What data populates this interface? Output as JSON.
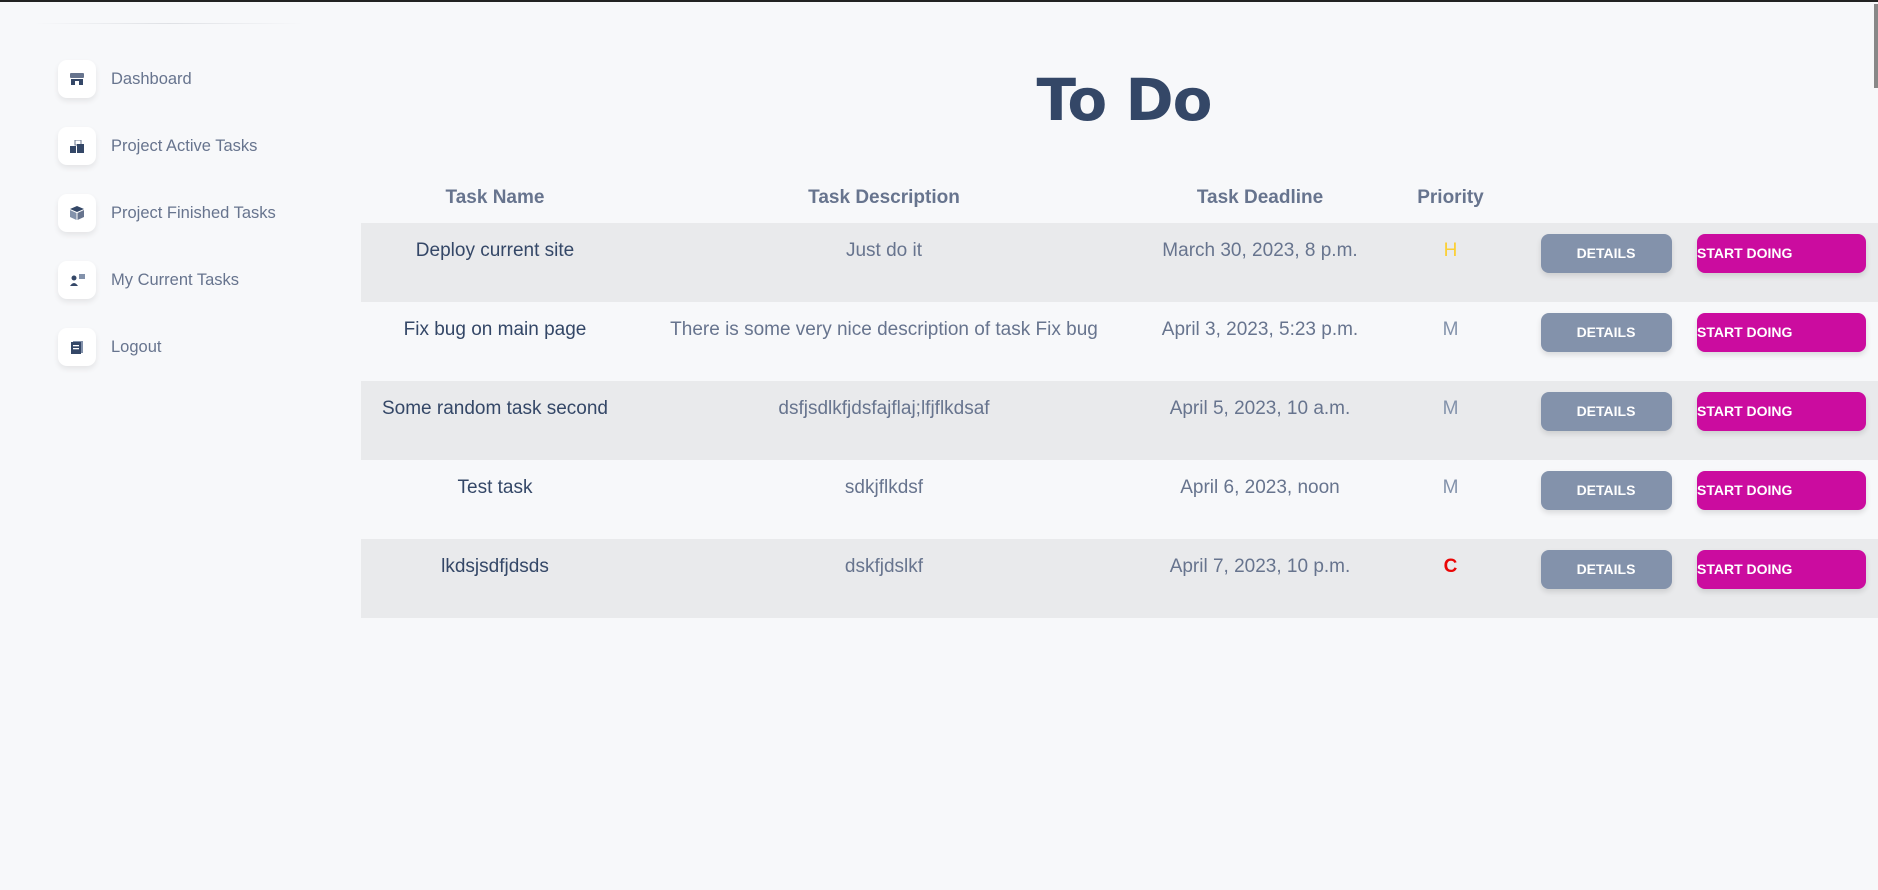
{
  "sidebar": {
    "items": [
      {
        "label": "Dashboard",
        "icon": "shop-icon"
      },
      {
        "label": "Project Active Tasks",
        "icon": "office-icon"
      },
      {
        "label": "Project Finished Tasks",
        "icon": "box-icon"
      },
      {
        "label": "My Current Tasks",
        "icon": "user-chat-icon"
      },
      {
        "label": "Logout",
        "icon": "document-icon"
      }
    ]
  },
  "page": {
    "title": "To Do"
  },
  "table": {
    "headers": [
      "Task Name",
      "Task Description",
      "Task Deadline",
      "Priority"
    ],
    "details_label": "DETAILS",
    "start_label": "START DOING",
    "rows": [
      {
        "name": "Deploy current site",
        "description": "Just do it",
        "deadline": "March 30, 2023, 8 p.m.",
        "priority": "H",
        "priority_color": "#fbcf33"
      },
      {
        "name": "Fix bug on main page",
        "description": "There is some very nice description of task Fix bug",
        "deadline": "April 3, 2023, 5:23 p.m.",
        "priority": "M",
        "priority_color": "#8392ab"
      },
      {
        "name": "Some random task second",
        "description": "dsfjsdlkfjdsfajflaj;lfjflkdsaf",
        "deadline": "April 5, 2023, 10 a.m.",
        "priority": "M",
        "priority_color": "#8392ab"
      },
      {
        "name": "Test task",
        "description": "sdkjflkdsf",
        "deadline": "April 6, 2023, noon",
        "priority": "M",
        "priority_color": "#8392ab"
      },
      {
        "name": "lkdsjsdfjdsds",
        "description": "dskfjdslkf",
        "deadline": "April 7, 2023, 10 p.m.",
        "priority": "C",
        "priority_color": "#ea0606"
      }
    ]
  }
}
